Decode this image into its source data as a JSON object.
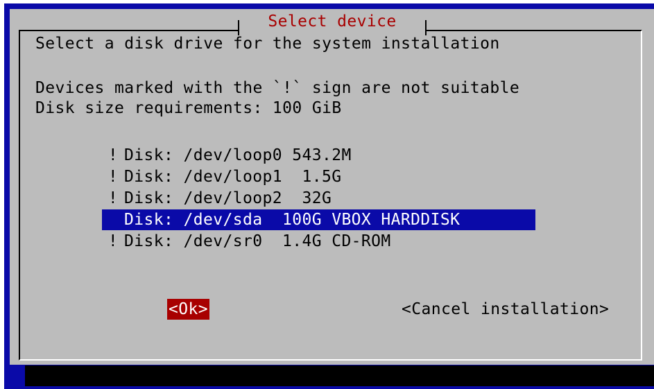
{
  "dialog": {
    "title": "Select device",
    "intro": "Select a disk drive for the system installation",
    "notice": "Devices marked with the `!` sign are not suitable",
    "requirement": "Disk size requirements: 100 GiB"
  },
  "devices": [
    {
      "mark": "!",
      "text": "Disk: /dev/loop0 543.2M",
      "selected": false
    },
    {
      "mark": "!",
      "text": "Disk: /dev/loop1  1.5G",
      "selected": false
    },
    {
      "mark": "!",
      "text": "Disk: /dev/loop2  32G",
      "selected": false
    },
    {
      "mark": "",
      "text": "Disk: /dev/sda  100G VBOX HARDDISK",
      "selected": true
    },
    {
      "mark": "!",
      "text": "Disk: /dev/sr0  1.4G CD-ROM",
      "selected": false
    }
  ],
  "buttons": {
    "ok": "<Ok>",
    "cancel": "<Cancel installation>"
  },
  "colors": {
    "background": "#0a0aa8",
    "dialog": "#bcbcbc",
    "title": "#a80000",
    "selection": "#0a0aa8",
    "active_button": "#a80000"
  }
}
